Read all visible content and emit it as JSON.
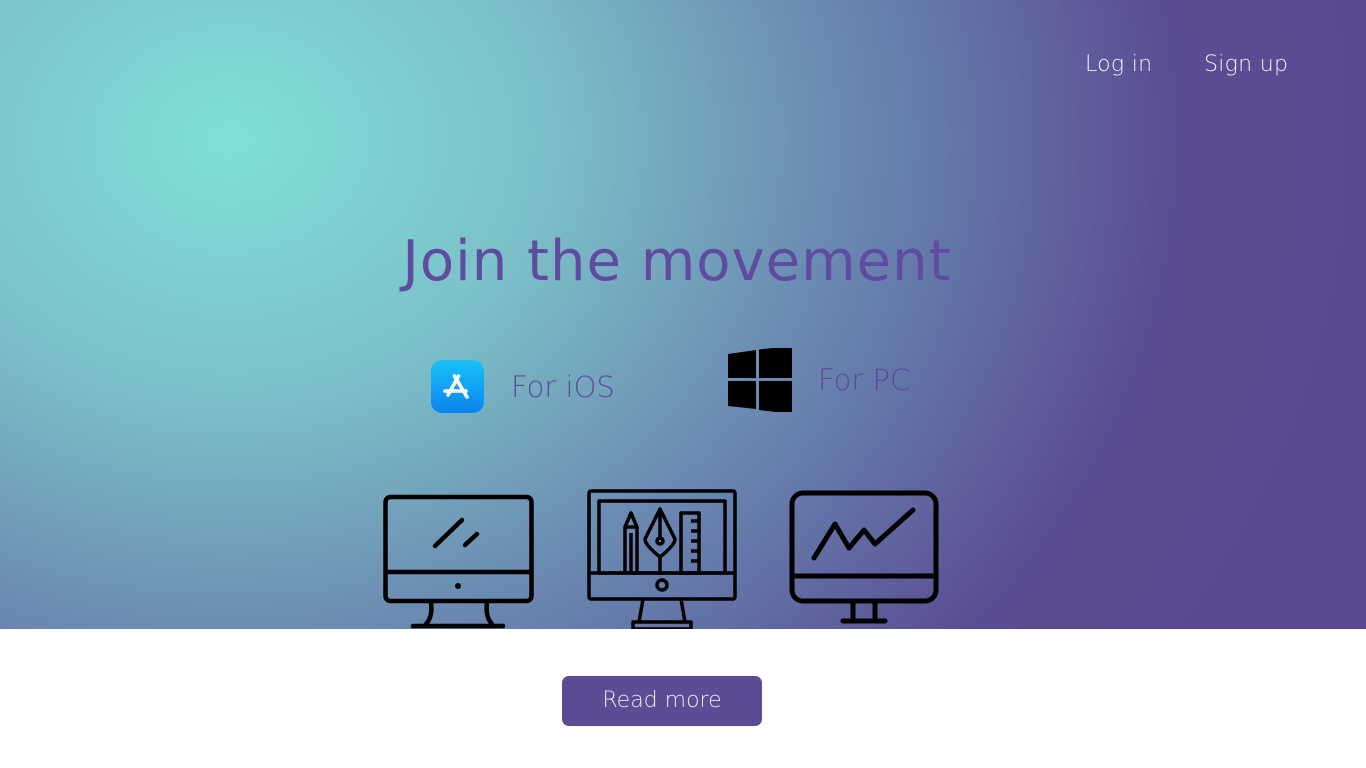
{
  "header": {
    "login_label": "Log in",
    "signup_label": "Sign up"
  },
  "hero": {
    "headline": "Join the movement",
    "downloads": [
      {
        "label": "For iOS",
        "icon": "app-store-icon"
      },
      {
        "label": "For PC",
        "icon": "windows-icon"
      }
    ],
    "illustrations": [
      {
        "icon": "desktop-monitor-icon"
      },
      {
        "icon": "design-tools-monitor-icon"
      },
      {
        "icon": "chart-monitor-icon"
      }
    ]
  },
  "cta": {
    "read_more_label": "Read more"
  },
  "colors": {
    "gradient_start": "#80e0d8",
    "gradient_end": "#5b4a91",
    "accent_purple": "#5b4c94",
    "headline_color": "#5f4ca0",
    "app_store_blue": "#0a84ef"
  }
}
